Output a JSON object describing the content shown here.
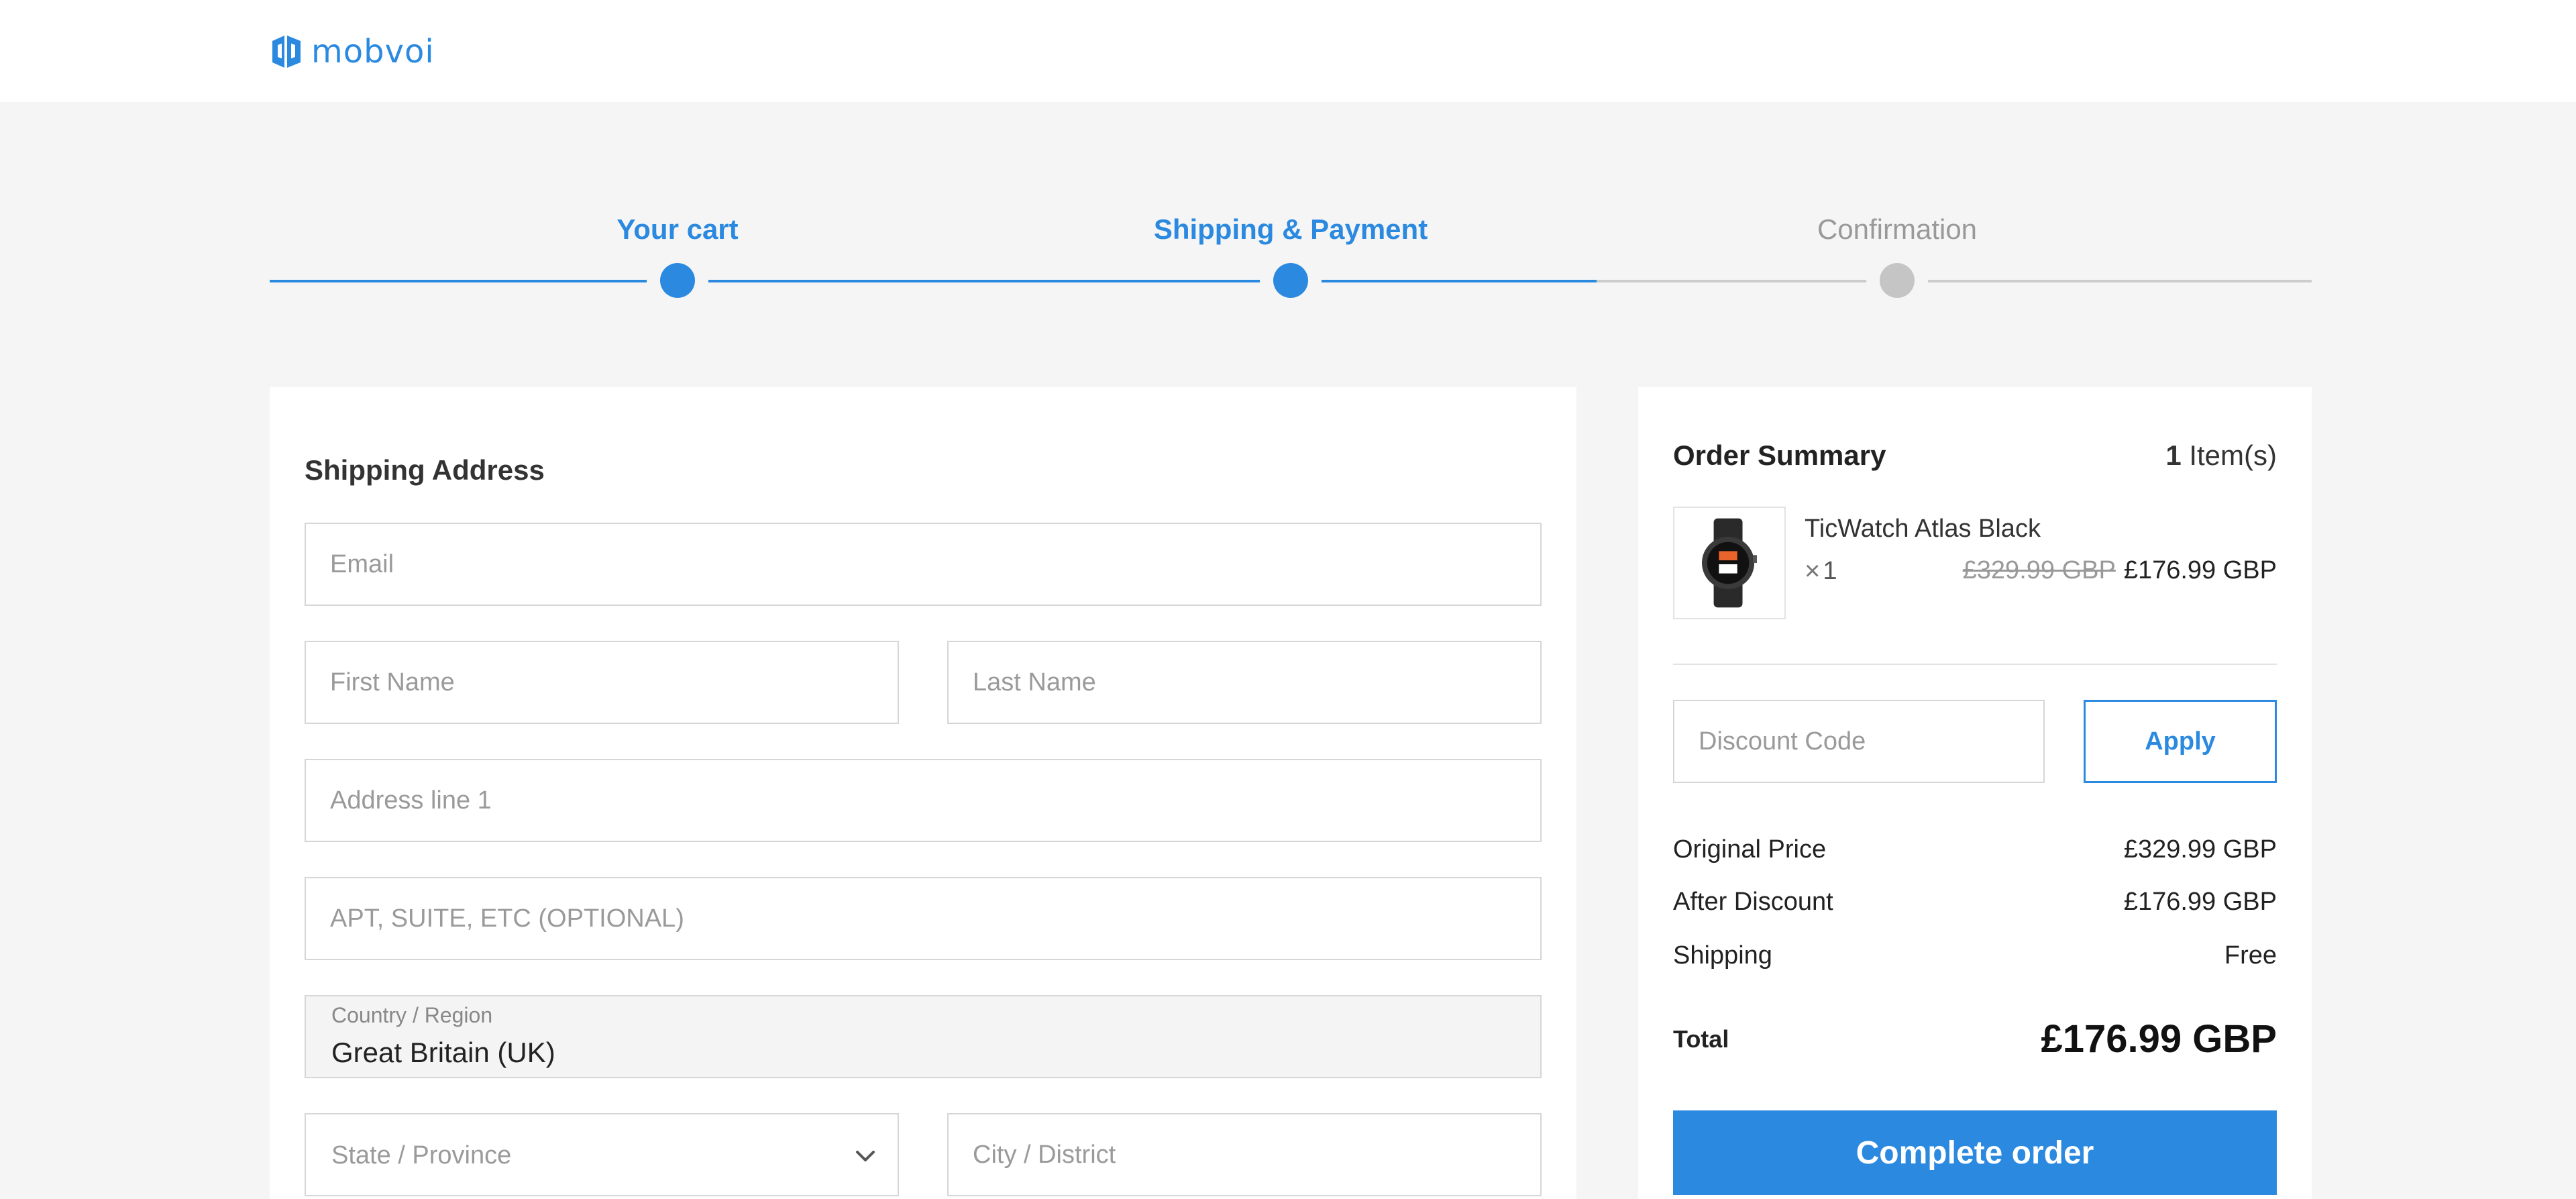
{
  "header": {
    "logo_text": "mobvoi",
    "brand_color": "#2b8ae0"
  },
  "steps": [
    {
      "label": "Your cart",
      "state": "active"
    },
    {
      "label": "Shipping & Payment",
      "state": "active"
    },
    {
      "label": "Confirmation",
      "state": "inactive"
    }
  ],
  "shipping": {
    "title": "Shipping Address",
    "email_placeholder": "Email",
    "first_name_placeholder": "First Name",
    "last_name_placeholder": "Last Name",
    "address1_placeholder": "Address line 1",
    "address2_placeholder": "APT, SUITE, ETC (OPTIONAL)",
    "country_label": "Country / Region",
    "country_value": "Great Britain (UK)",
    "state_placeholder": "State / Province",
    "city_placeholder": "City / District"
  },
  "summary": {
    "title": "Order Summary",
    "item_count": "1",
    "item_count_suffix": " Item(s)",
    "product": {
      "name": "TicWatch Atlas Black",
      "qty_symbol": "×",
      "qty": "1",
      "original_price": "£329.99 GBP",
      "sale_price": "£176.99 GBP"
    },
    "discount_placeholder": "Discount Code",
    "apply_label": "Apply",
    "rows": [
      {
        "label": "Original Price",
        "value": "£329.99 GBP"
      },
      {
        "label": "After Discount",
        "value": "£176.99 GBP"
      },
      {
        "label": "Shipping",
        "value": "Free"
      }
    ],
    "total_label": "Total",
    "total_value": "£176.99 GBP",
    "complete_label": "Complete order"
  }
}
